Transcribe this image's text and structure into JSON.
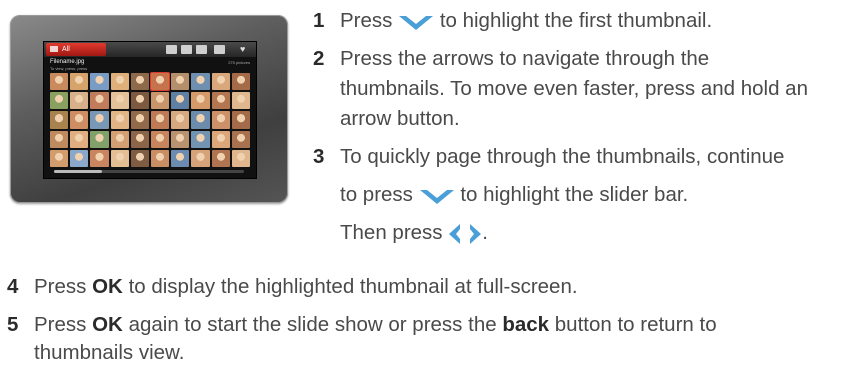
{
  "device": {
    "screen_tab_label": "All",
    "file_name": "Filename.jpg",
    "file_info": "To view, press, press",
    "photo_count": "275 pictures",
    "thumbnail_colors": [
      "#c98b5e",
      "#d6a36b",
      "#7a9bc4",
      "#e0b07a",
      "#8f6a4a",
      "#c4734c",
      "#b58e6c",
      "#6f8fb0",
      "#d9a77c",
      "#a56a48",
      "#8aa060",
      "#d8b08a",
      "#c27b5b",
      "#e3c29a",
      "#7d5a3f",
      "#c9956b",
      "#5f7fa3",
      "#d49a6a",
      "#b47551",
      "#e0b890",
      "#a8834f",
      "#cf8d63",
      "#7898b6",
      "#e2b584",
      "#916a4c",
      "#bd7a55",
      "#d7a981",
      "#6c8cae",
      "#cc9168",
      "#a46b4a",
      "#c08a60",
      "#e0ae80",
      "#82a06a",
      "#d59f74",
      "#8c6447",
      "#c7845d",
      "#b99270",
      "#7393b3",
      "#dba679",
      "#a87150",
      "#d39c6c",
      "#8ba7c9",
      "#c98460",
      "#e4bf94",
      "#7e5d42",
      "#ca8e64",
      "#6b8bb0",
      "#d6a27a",
      "#b07452",
      "#dfb68d"
    ],
    "selected_thumbnail_index": 5,
    "slider_position": 0.25
  },
  "steps": [
    {
      "number": "1",
      "text_a": "Press",
      "text_b": "to highlight the first thumbnail."
    },
    {
      "number": "2",
      "lines": [
        "Press the arrows to navigate through the",
        "thumbnails. To move even faster, press and hold an",
        "arrow button."
      ]
    },
    {
      "number": "3",
      "lines": [
        "To quickly page through the thumbnails, continue"
      ],
      "line2_a": "to press",
      "line2_b": "to highlight the slider bar.",
      "line3_a": "Then press",
      "line3_b": "."
    },
    {
      "number": "4",
      "text_a": "Press",
      "kw": "OK",
      "text_b": "to display the highlighted thumbnail at full-screen."
    },
    {
      "number": "5",
      "text_a": "Press",
      "kw": "OK",
      "text_b": "again to start the slide show or press the",
      "kw2": "back",
      "text_c": "button to return to",
      "line2": "thumbnails view."
    }
  ],
  "colors": {
    "accent": "#4a9fd8",
    "text": "#4a4a4a",
    "tab_red": "#e03a2f"
  },
  "icons": {
    "down": "chevron-down-icon",
    "left_right": "left-right-arrows-icon"
  }
}
